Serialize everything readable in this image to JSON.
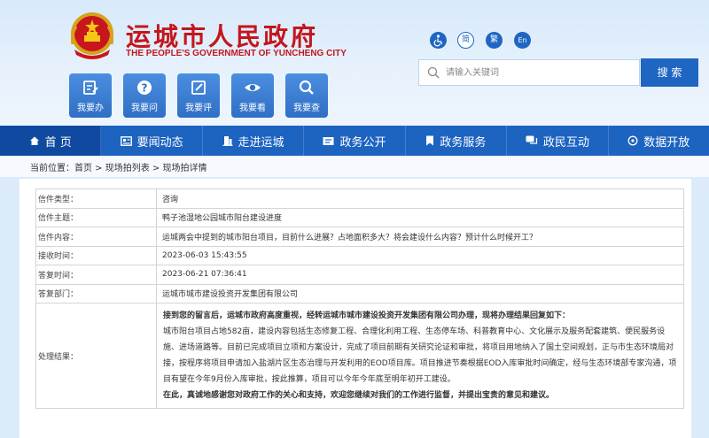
{
  "header": {
    "title_cn": "运城市人民政府",
    "title_en": "THE PEOPLE'S GOVERNMENT OF YUNCHENG  CITY"
  },
  "quick_links": [
    {
      "label": "我要办",
      "icon": "edit-note-icon"
    },
    {
      "label": "我要问",
      "icon": "question-icon"
    },
    {
      "label": "我要评",
      "icon": "pencil-box-icon"
    },
    {
      "label": "我要看",
      "icon": "eye-icon"
    },
    {
      "label": "我要查",
      "icon": "search-icon"
    }
  ],
  "accessibility": {
    "accessible_icon": "wheelchair-icon",
    "simplified": "简",
    "traditional": "繁",
    "english": "En"
  },
  "search": {
    "placeholder": "请输入关键词",
    "button": "搜 索"
  },
  "nav": [
    {
      "label": "首 页",
      "icon": "home-icon",
      "active": true
    },
    {
      "label": "要闻动态",
      "icon": "news-icon"
    },
    {
      "label": "走进运城",
      "icon": "building-icon"
    },
    {
      "label": "政务公开",
      "icon": "doc-icon"
    },
    {
      "label": "政务服务",
      "icon": "bookmark-icon"
    },
    {
      "label": "政民互动",
      "icon": "chat-icon"
    },
    {
      "label": "数据开放",
      "icon": "data-icon"
    }
  ],
  "breadcrumb": {
    "prefix": "当前位置：",
    "items": [
      "首页",
      "现场拍列表",
      "现场拍详情"
    ],
    "sep": " > "
  },
  "detail": {
    "rows": [
      {
        "key": "信件类型：",
        "value": "咨询"
      },
      {
        "key": "信件主题：",
        "value": "鸭子池湿地公园城市阳台建设进度"
      },
      {
        "key": "信件内容：",
        "value": "运城两会中提到的城市阳台项目，目前什么进展？占地面积多大？将会建设什么内容？预计什么时候开工？"
      },
      {
        "key": "接收时间：",
        "value": "2023-06-03 15:43:55"
      },
      {
        "key": "答复时间：",
        "value": "2023-06-21 07:36:41"
      },
      {
        "key": "答复部门：",
        "value": "运城市城市建设投资开发集团有限公司"
      }
    ],
    "result_key": "处理结果：",
    "result_intro": "接到您的留言后，运城市政府高度重视，经转运城市城市建设投资开发集团有限公司办理，现将办理结果回复如下：",
    "result_body": "城市阳台项目占地582亩，建设内容包括生态修复工程、合理化利用工程、生态停车场、科普教育中心、文化展示及服务配套建筑、便民服务设施、进场道路等。目前已完成项目立项和方案设计，完成了项目前期有关研究论证和审批，将项目用地纳入了国土空间规划，正与市生态环境局对接，按程序将项目申请加入盐湖片区生态治理与开发利用的EOD项目库。项目推进节奏根据EOD入库审批时间确定，经与生态环境部专家沟通，项目有望在今年9月份入库审批，按此推算，项目可以今年今年底至明年初开工建设。",
    "result_outro": "在此，真诚地感谢您对政府工作的关心和支持，欢迎您继续对我们的工作进行监督，并提出宝贵的意见和建议。"
  },
  "colors": {
    "brand_red": "#c4161c",
    "nav_blue": "#1d63c0",
    "nav_active": "#0f4aa0",
    "page_bg": "#dcebfa"
  }
}
